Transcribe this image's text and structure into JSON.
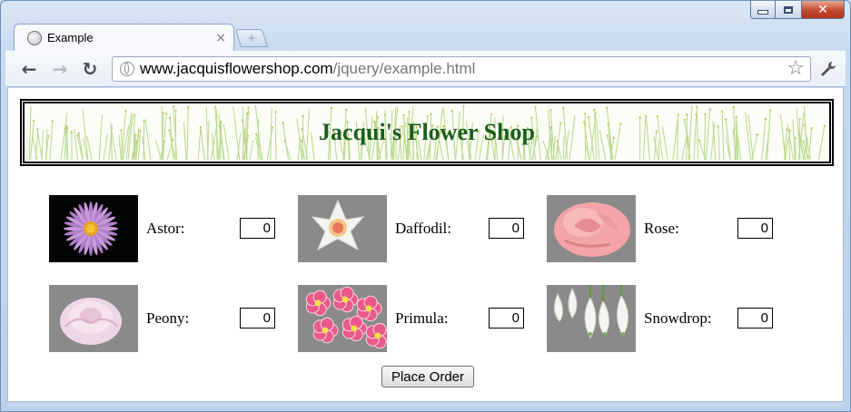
{
  "window": {
    "controls": {
      "minimize": "minimize",
      "maximize": "maximize",
      "close": "close"
    }
  },
  "tab": {
    "title": "Example",
    "close_glyph": "×"
  },
  "newtab_glyph": "+",
  "toolbar": {
    "back_glyph": "←",
    "forward_glyph": "→",
    "reload_glyph": "↻",
    "url_domain": "www.jacquisflowershop.com",
    "url_path": "/jquery/example.html",
    "star_glyph": "☆"
  },
  "page": {
    "shop_title": "Jacqui's Flower Shop",
    "order_button": "Place Order",
    "flowers": [
      {
        "name": "Astor:",
        "qty": "0",
        "image": "aster-photo"
      },
      {
        "name": "Daffodil:",
        "qty": "0",
        "image": "daffodil-photo"
      },
      {
        "name": "Rose:",
        "qty": "0",
        "image": "rose-photo"
      },
      {
        "name": "Peony:",
        "qty": "0",
        "image": "peony-photo"
      },
      {
        "name": "Primula:",
        "qty": "0",
        "image": "primula-photo"
      },
      {
        "name": "Snowdrop:",
        "qty": "0",
        "image": "snowdrop-photo"
      }
    ]
  },
  "colors": {
    "title_green": "#1a5e1a",
    "photo_gray": "#8a8a8a"
  }
}
